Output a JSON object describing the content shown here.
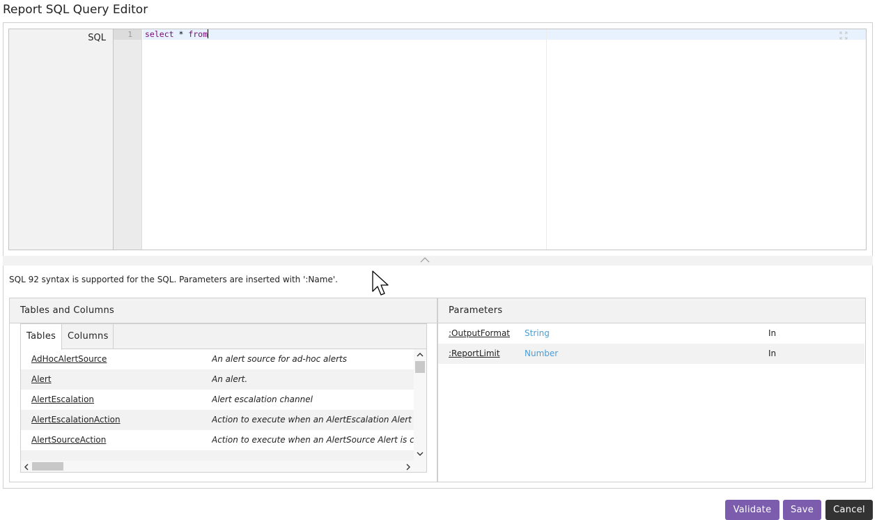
{
  "window": {
    "title": "Report SQL Query Editor"
  },
  "sql_editor": {
    "label": "SQL",
    "line_numbers": [
      "1"
    ],
    "code_keyword_1": "select",
    "code_middle": " * ",
    "code_keyword_2": "from",
    "icons": {
      "fullscreen": "expand-icon"
    }
  },
  "collapse_icon": "chevron-up-icon",
  "help_text": "SQL 92 syntax is supported for the SQL. Parameters are inserted with ':Name'.",
  "tables_panel": {
    "title": "Tables and Columns",
    "tabs": [
      {
        "label": "Tables",
        "active": true
      },
      {
        "label": "Columns",
        "active": false
      }
    ],
    "rows": [
      {
        "name": "AdHocAlertSource",
        "description": "An alert source for ad-hoc alerts"
      },
      {
        "name": "Alert",
        "description": "An alert."
      },
      {
        "name": "AlertEscalation",
        "description": "Alert escalation channel"
      },
      {
        "name": "AlertEscalationAction",
        "description": "Action to execute when an AlertEscalation Alert is executed"
      },
      {
        "name": "AlertSourceAction",
        "description": "Action to execute when an AlertSource Alert is created"
      }
    ]
  },
  "parameters_panel": {
    "title": "Parameters",
    "rows": [
      {
        "name": ":OutputFormat",
        "type": "String",
        "direction": "In"
      },
      {
        "name": ":ReportLimit",
        "type": "Number",
        "direction": "In"
      }
    ]
  },
  "buttons": {
    "validate": "Validate",
    "save": "Save",
    "cancel": "Cancel"
  },
  "colors": {
    "accent": "#7b5cad",
    "cancel": "#333333",
    "link_blue": "#4a9ed6"
  }
}
